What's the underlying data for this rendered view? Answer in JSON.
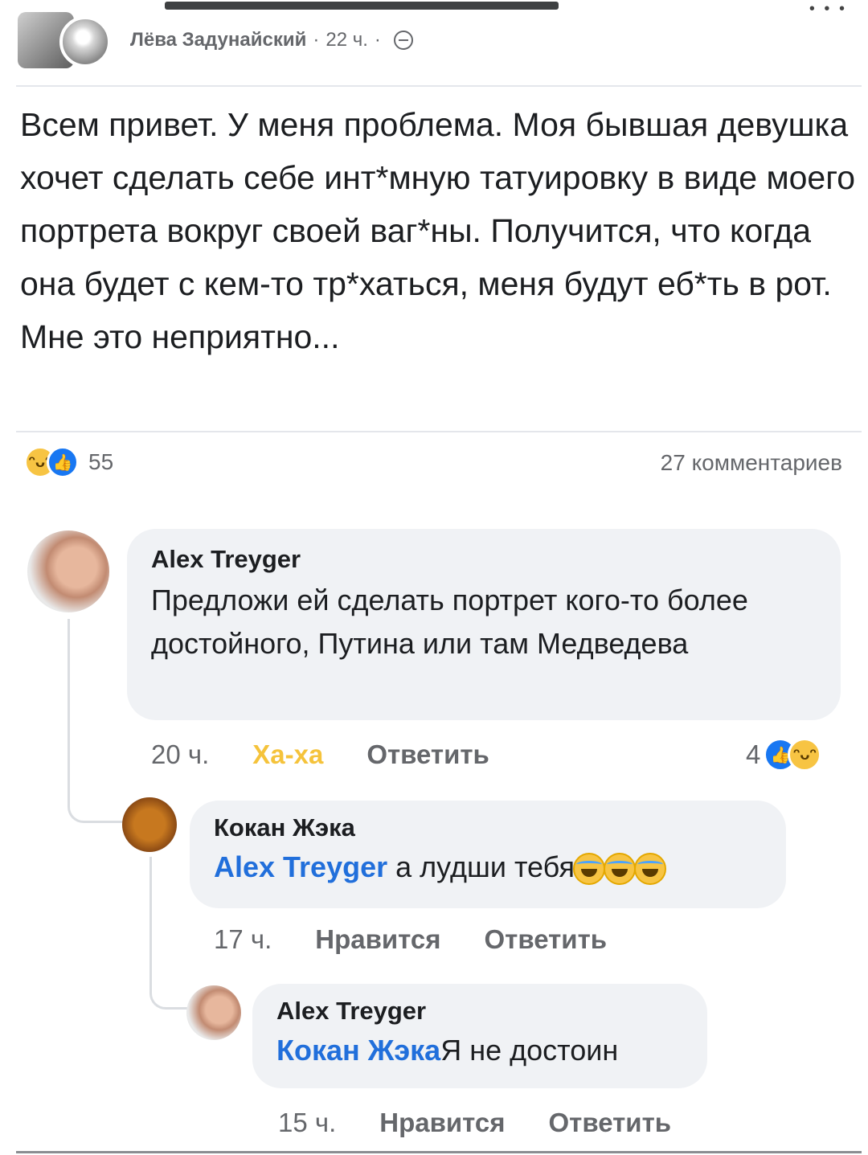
{
  "post": {
    "author": "Лёва Задунайский",
    "time": "22 ч.",
    "separator": "·",
    "text": "Всем привет. У меня проблема. Моя бывшая девушка хочет сделать себе инт*мную татуировку в виде моего портрета вокруг своей ваг*ны. Получится, что когда она будет с кем-то тр*хаться, меня будут еб*ть в рот. Мне это неприятно...",
    "reactions_count": "55",
    "comments_count": "27 комментариев",
    "icons": [
      "haha-reaction-icon",
      "like-reaction-icon",
      "globe-icon"
    ]
  },
  "comments": [
    {
      "author": "Alex Treyger",
      "text": "Предложи ей сделать портрет кого-то более достойного, Путина или там Медведева",
      "time": "20 ч.",
      "reaction_label": "Ха-ха",
      "reply_label": "Ответить",
      "reactions_count": "4"
    },
    {
      "author": "Кокан Жэка",
      "mention": "Alex Treyger",
      "text": "а лудши тебя",
      "time": "17 ч.",
      "like_label": "Нравится",
      "reply_label": "Ответить"
    },
    {
      "author": "Alex Treyger",
      "mention": "Кокан Жэка",
      "text": "Я не достоин",
      "time": "15 ч.",
      "like_label": "Нравится",
      "reply_label": "Ответить"
    }
  ],
  "colors": {
    "mention": "#216fdb",
    "haha": "#f5c33b",
    "like": "#1877f2",
    "bubble": "#f0f2f5",
    "muted": "#65676b"
  }
}
